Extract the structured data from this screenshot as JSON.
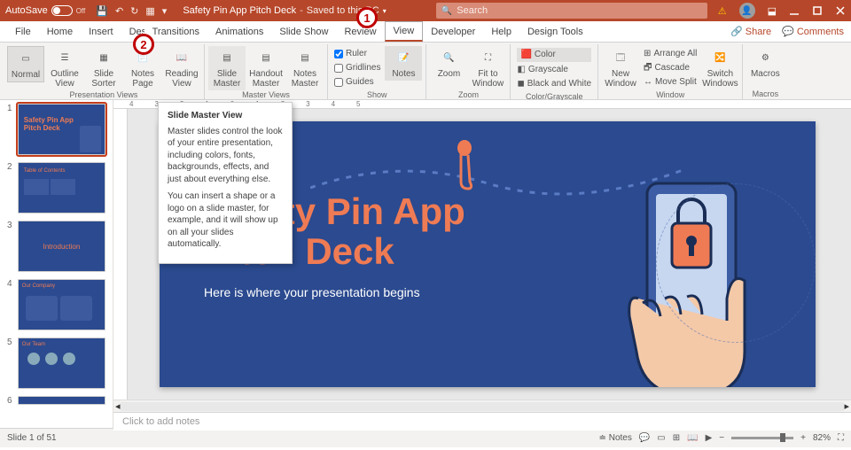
{
  "titlebar": {
    "autosave_label": "AutoSave",
    "autosave_state": "Off",
    "doc_title": "Safety Pin App Pitch Deck",
    "save_status": "Saved to this PC",
    "search_placeholder": "Search"
  },
  "tabs": {
    "file": "File",
    "home": "Home",
    "insert": "Insert",
    "design": "Design",
    "transitions": "Transitions",
    "animations": "Animations",
    "slideshow": "Slide Show",
    "review": "Review",
    "view": "View",
    "developer": "Developer",
    "help": "Help",
    "designtools": "Design Tools",
    "share": "Share",
    "comments": "Comments"
  },
  "ribbon": {
    "presentation_views": "Presentation Views",
    "normal": "Normal",
    "outline": "Outline View",
    "sorter": "Slide Sorter",
    "notespage": "Notes Page",
    "reading": "Reading View",
    "master_views": "Master Views",
    "slidemaster": "Slide Master",
    "handoutmaster": "Handout Master",
    "notesmaster": "Notes Master",
    "show": "Show",
    "ruler": "Ruler",
    "gridlines": "Gridlines",
    "guides": "Guides",
    "notes": "Notes",
    "zoom_group": "Zoom",
    "zoom": "Zoom",
    "fitwindow": "Fit to Window",
    "colorgray": "Color/Grayscale",
    "color": "Color",
    "grayscale": "Grayscale",
    "bw": "Black and White",
    "window_group": "Window",
    "newwindow": "New Window",
    "arrangeall": "Arrange All",
    "cascade": "Cascade",
    "movesplit": "Move Split",
    "switchwin": "Switch Windows",
    "macros_group": "Macros",
    "macros": "Macros"
  },
  "tooltip": {
    "title": "Slide Master View",
    "p1": "Master slides control the look of your entire presentation, including colors, fonts, backgrounds, effects, and just about everything else.",
    "p2": "You can insert a shape or a logo on a slide master, for example, and it will show up on all your slides automatically."
  },
  "annotations": {
    "a1": "1",
    "a2": "2"
  },
  "slide": {
    "title_line1": "Safety Pin App",
    "title_line2": "Pitch Deck",
    "subtitle": "Here is where your presentation begins"
  },
  "thumbs": {
    "t1_l1": "Safety Pin App",
    "t1_l2": "Pitch Deck",
    "t2": "Table of Contents",
    "t3": "Introduction",
    "t4": "Our Company",
    "t5": "Our Team"
  },
  "notes_placeholder": "Click to add notes",
  "statusbar": {
    "slide_info": "Slide 1 of 51",
    "notes_btn": "Notes",
    "zoom_pct": "82%"
  },
  "ruler_text": "4321012345"
}
